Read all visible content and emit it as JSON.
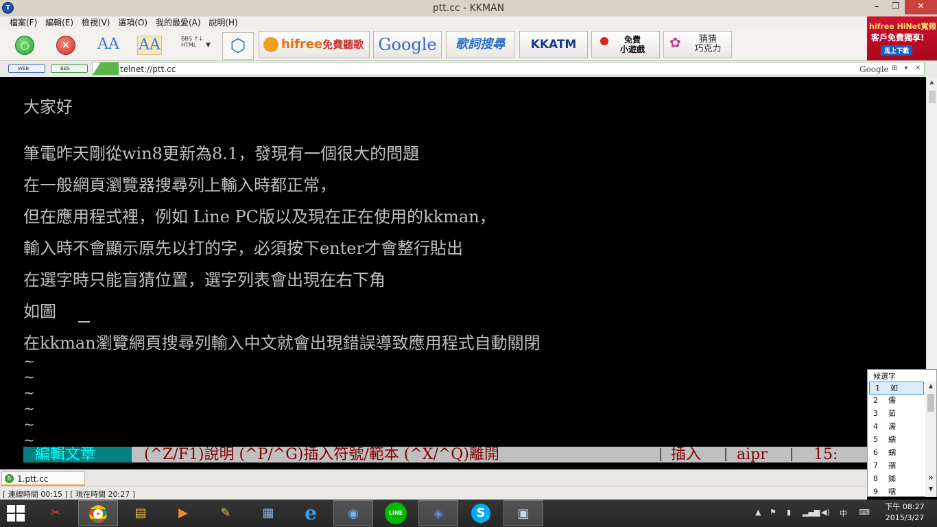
{
  "window": {
    "title": "ptt.cc - KKMAN",
    "controls": {
      "minimize": "–",
      "restore": "❐",
      "close": "✕"
    }
  },
  "menu": [
    "檔案(F)",
    "編輯(E)",
    "檢視(V)",
    "選項(O)",
    "我的最愛(A)",
    "說明(H)"
  ],
  "toolbar": {
    "bbs_html_label": "BBS ↑↓ HTML",
    "hifree_label": "hifree",
    "hifree_tag": "免費聽歌",
    "google_label": "Google",
    "lyrics_label": "歌詞搜尋",
    "kkatm_label": "KKATM",
    "game_label_1": "免費",
    "game_label_2": "小遊戲",
    "guess_label_1": "猜猜",
    "guess_label_2": "巧克力"
  },
  "ad": {
    "brand": "hifree HiNet寬頻",
    "line2": "客戶免費獨享!",
    "cta": "馬上下載"
  },
  "address": {
    "mode_web": "WEB",
    "mode_bbs": "BBS",
    "url": "telnet://ptt.cc",
    "search_engine": "Google"
  },
  "terminal": {
    "lines": [
      "大家好",
      "筆電昨天剛從win8更新為8.1，發現有一個很大的問題",
      "在一般網頁瀏覽器搜尋列上輸入時都正常，",
      "但在應用程式裡，例如 Line PC版以及現在正在使用的kkman，",
      "輸入時不會顯示原先以打的字，必須按下enter才會整行貼出",
      "在選字時只能盲猜位置，選字列表會出現在右下角",
      "如圖",
      "在kkman瀏覽網頁搜尋列輸入中文就會出現錯誤導致應用程式自動關閉"
    ],
    "tildes": [
      "~",
      "~",
      "~",
      "~",
      "~",
      "~"
    ],
    "status": {
      "mode": "編輯文章",
      "help": "(^Z/F1)說明 (^P/^G)插入符號/範本 (^X/^Q)離開",
      "insert": "插入",
      "input": "aipr",
      "pos": "15:"
    }
  },
  "candidates": {
    "title": "候選字",
    "items": [
      {
        "num": "1",
        "char": "如"
      },
      {
        "num": "2",
        "char": "儒"
      },
      {
        "num": "3",
        "char": "茹"
      },
      {
        "num": "4",
        "char": "濡"
      },
      {
        "num": "5",
        "char": "繻"
      },
      {
        "num": "6",
        "char": "蠕"
      },
      {
        "num": "7",
        "char": "孺"
      },
      {
        "num": "8",
        "char": "銣"
      },
      {
        "num": "9",
        "char": "嚅"
      }
    ],
    "selected_index": 0
  },
  "tabs": [
    {
      "label": "1.ptt.cc"
    }
  ],
  "statusbar": {
    "text": "[ 連線時間 00:15 ] [ 現在時間 20:27 ]"
  },
  "taskbar": {
    "apps": [
      "snipping-tool",
      "chrome",
      "file-explorer",
      "media-player",
      "paint",
      "calculator",
      "internet-explorer",
      "media-center",
      "line",
      "kkman",
      "skype",
      "remote-desktop"
    ],
    "line_label": "LINE",
    "ie_label": "e",
    "skype_label": "S",
    "ime_label": "中",
    "clock_ampm_time": "下午 08:27",
    "clock_date": "2015/3/27"
  }
}
